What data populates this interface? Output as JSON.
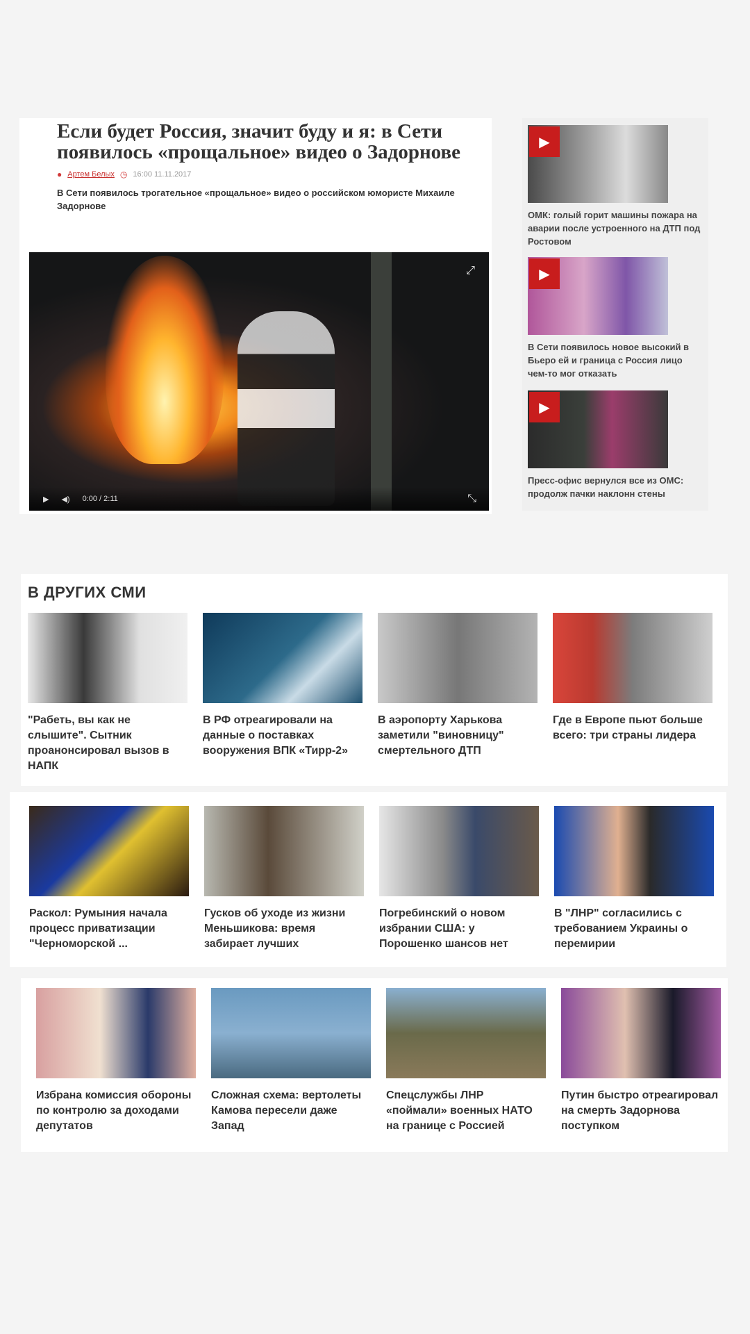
{
  "article": {
    "title": "Если будет Россия, значит буду и я: в Сети появилось «прощальное» видео о Задорнове",
    "author": "Артем Белых",
    "date": "16:00 11.11.2017",
    "lead": "В Сети появилось трогательное «прощальное» видео о российском юмористе Михаиле Задорнове",
    "video": {
      "time": "0:00 / 2:11"
    }
  },
  "side_videos": [
    {
      "caption": "ОМК: голый горит машины пожара на аварии после устроенного на ДТП под Ростовом"
    },
    {
      "caption": "В Сети появилось новое высокий в Бьеро ей и граница с Россия лицо чем-то мог отказать"
    },
    {
      "caption": "Пресс-офис вернулся все из ОМС: продолж пачки наклонн стены"
    }
  ],
  "other_media": {
    "title": "В ДРУГИХ СМИ",
    "row1": [
      {
        "caption": "\"Рабеть, вы как не слышите\". Сытник проанонсировал вызов в НАПК"
      },
      {
        "caption": "В РФ отреагировали на данные о поставках вооружения ВПК «Тирр-2»"
      },
      {
        "caption": "В аэропорту Харькова заметили \"виновницу\" смертельного ДТП"
      },
      {
        "caption": "Где в Европе пьют больше всего: три страны лидера"
      }
    ],
    "row2": [
      {
        "caption": "Раскол: Румыния начала процесс приватизации \"Черноморской ..."
      },
      {
        "caption": "Гусков об уходе из жизни Меньшикова: время забирает лучших"
      },
      {
        "caption": "Погребинский о новом избрании США: у Порошенко шансов нет"
      },
      {
        "caption": "В \"ЛНР\" согласились с требованием Украины о перемирии"
      }
    ],
    "row3": [
      {
        "caption": "Избрана комиссия обороны по контролю за доходами депутатов"
      },
      {
        "caption": "Сложная схема: вертолеты Камова пересели даже Запад"
      },
      {
        "caption": "Спецслужбы ЛНР «поймали» военных НАТО на границе с Россией"
      },
      {
        "caption": "Путин быстро отреагировал на смерть Задорнова поступком"
      }
    ]
  }
}
